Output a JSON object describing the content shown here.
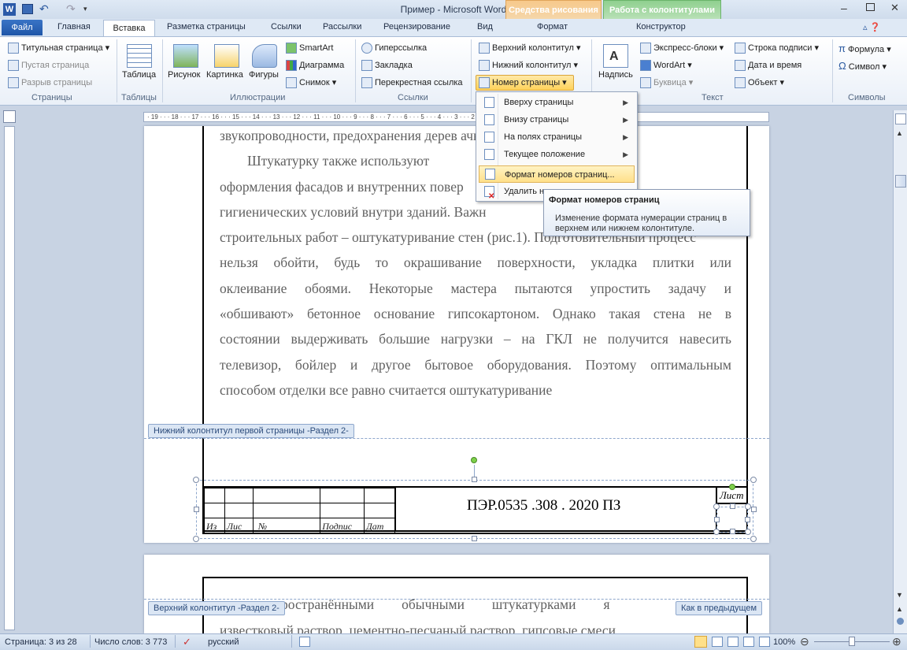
{
  "title": "Пример  -  Microsoft Word",
  "contextual": {
    "drawing": "Средства рисования",
    "headers": "Работа с колонтитулами"
  },
  "tabs": [
    "Файл",
    "Главная",
    "Вставка",
    "Разметка страницы",
    "Ссылки",
    "Рассылки",
    "Рецензирование",
    "Вид",
    "Формат",
    "Конструктор"
  ],
  "ribbon": {
    "pages": {
      "cover": "Титульная страница",
      "blank": "Пустая страница",
      "break": "Разрыв страницы",
      "group": "Страницы"
    },
    "tables": {
      "table": "Таблица",
      "group": "Таблицы"
    },
    "illustrations": {
      "picture": "Рисунок",
      "clipart": "Картинка",
      "shapes": "Фигуры",
      "smartart": "SmartArt",
      "chart": "Диаграмма",
      "screenshot": "Снимок",
      "group": "Иллюстрации"
    },
    "links": {
      "hyperlink": "Гиперссылка",
      "bookmark": "Закладка",
      "crossref": "Перекрестная ссылка",
      "group": "Ссылки"
    },
    "hf": {
      "header": "Верхний колонтитул",
      "footer": "Нижний колонтитул",
      "pagenum": "Номер страницы"
    },
    "text": {
      "textbox": "Надпись",
      "quickparts": "Экспресс-блоки",
      "wordart": "WordArt",
      "dropcap": "Буквица",
      "sigline": "Строка подписи",
      "datetime": "Дата и время",
      "object": "Объект",
      "group": "Текст"
    },
    "symbols": {
      "equation": "Формула",
      "symbol": "Символ",
      "group": "Символы"
    }
  },
  "ruler": "· 19 · · · 18 · · · 17 · · · 16 · · · 15 · · · 14 · · · 13 · · · 12 · · · 11 · · · 10 · · · 9 · · · 8 · · · 7 · · · 6 · · · 5 · · · 4 · · · 3 · · · 2 · · · 1 · · · · · 1 · · · 2 · · ·",
  "document": {
    "lines": [
      "звукопроводности, предохранения дерев                      ачнения.",
      "        Штукатурку также используют                  художественного",
      "оформления фасадов и внутренних повер                   ихся санитарно-",
      "гигиенических условий внутри зданий. Важн",
      "строительных работ – оштукатуривание стен (рис.1). Подготовительный процесс",
      "нельзя обойти, будь то окрашивание поверхности, укладка плитки или",
      "оклеивание обоями. Некоторые мастера пытаются упростить задачу и",
      "«обшивают» бетонное основание гипсокартоном. Однако такая стена не в",
      "состоянии выдерживать большие нагрузки – на ГКЛ не получится навесить",
      "телевизор, бойлер и другое бытовое оборудования. Поэтому оптимальным",
      "способом отделки все равно считается оштукатуривание"
    ],
    "footer_label": "Нижний колонтитул первой страницы -Раздел 2-",
    "header_label": "Верхний колонтитул -Раздел 2-",
    "same_as_prev": "Как в предыдущем",
    "stamp": {
      "cols": [
        "Из",
        "Лис",
        "№",
        "Подпис",
        "Дат"
      ],
      "code": "ПЭР.0535 .308 . 2020  ПЗ",
      "sheet": "Лист"
    },
    "page2_line": "и        распространёнными        обычными        штукатурками        я",
    "page2_line2": "известковый раствор, цементно-песчаный раствор, гипсовые смеси"
  },
  "menu": {
    "items": [
      "Вверху страницы",
      "Внизу страницы",
      "На полях страницы",
      "Текущее положение",
      "Формат номеров страниц...",
      "Удалить н"
    ]
  },
  "tooltip": {
    "title": "Формат номеров страниц",
    "body": "Изменение формата нумерации страниц в верхнем или нижнем колонтитуле."
  },
  "status": {
    "page": "Страница: 3 из 28",
    "words": "Число слов: 3 773",
    "lang": "русский",
    "zoom": "100%"
  }
}
